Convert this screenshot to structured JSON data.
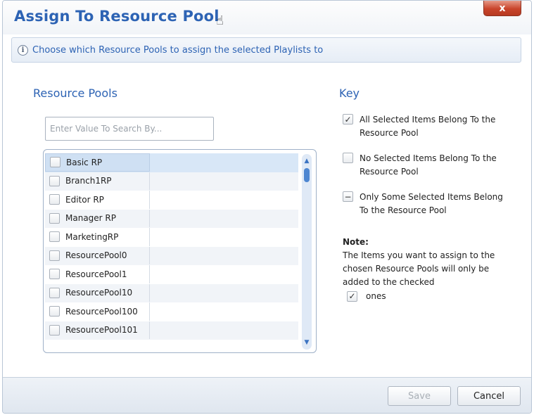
{
  "dialog": {
    "title": "Assign To Resource Pool",
    "close_label": "x",
    "info_text": "Choose which Resource Pools to assign the selected Playlists to"
  },
  "resource_pools": {
    "heading": "Resource Pools",
    "search_placeholder": "Enter Value To Search By...",
    "items": [
      {
        "label": "Basic RP"
      },
      {
        "label": "Branch1RP"
      },
      {
        "label": "Editor RP"
      },
      {
        "label": "Manager RP"
      },
      {
        "label": "MarketingRP"
      },
      {
        "label": "ResourcePool0"
      },
      {
        "label": "ResourcePool1"
      },
      {
        "label": "ResourcePool10"
      },
      {
        "label": "ResourcePool100"
      },
      {
        "label": "ResourcePool101"
      }
    ]
  },
  "key": {
    "heading": "Key",
    "all_selected": "All Selected Items Belong To the Resource Pool",
    "none_selected": "No Selected Items Belong To the Resource Pool",
    "some_selected": "Only Some Selected Items Belong To the Resource Pool"
  },
  "note": {
    "title": "Note:",
    "body": "The Items you want to assign to the chosen Resource Pools will only be added to the checked",
    "tail": "ones"
  },
  "footer": {
    "save_label": "Save",
    "cancel_label": "Cancel"
  }
}
